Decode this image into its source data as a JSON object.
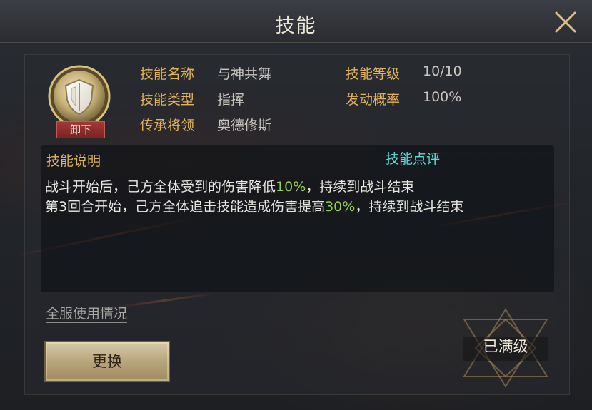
{
  "header": {
    "title": "技能"
  },
  "skill": {
    "unequip_label": "卸下",
    "name_label": "技能名称",
    "name_value": "与神共舞",
    "type_label": "技能类型",
    "type_value": "指挥",
    "inherit_label": "传承将领",
    "inherit_value": "奥德修斯",
    "level_label": "技能等级",
    "level_value": "10/10",
    "chance_label": "发动概率",
    "chance_value": "100%"
  },
  "description": {
    "title": "技能说明",
    "review_link": "技能点评",
    "line1_a": "战斗开始后，己方全体受到的伤害降低",
    "line1_hl": "10%",
    "line1_b": "，持续到战斗结束",
    "line2_a": "第3回合开始，己方全体追击技能造成伤害提高",
    "line2_hl": "30%",
    "line2_b": "，持续到战斗结束"
  },
  "footer": {
    "usage_link": "全服使用情况",
    "replace_button": "更换",
    "max_level": "已满级"
  },
  "colors": {
    "gold_label": "#e2b35a",
    "highlight_green": "#8fd14a",
    "link_cyan": "#5fd9d9",
    "unequip_red": "#a23a36"
  },
  "icons": {
    "close": "close-x-icon",
    "skill": "shield-skill-icon",
    "emblem": "star-emblem-icon"
  }
}
